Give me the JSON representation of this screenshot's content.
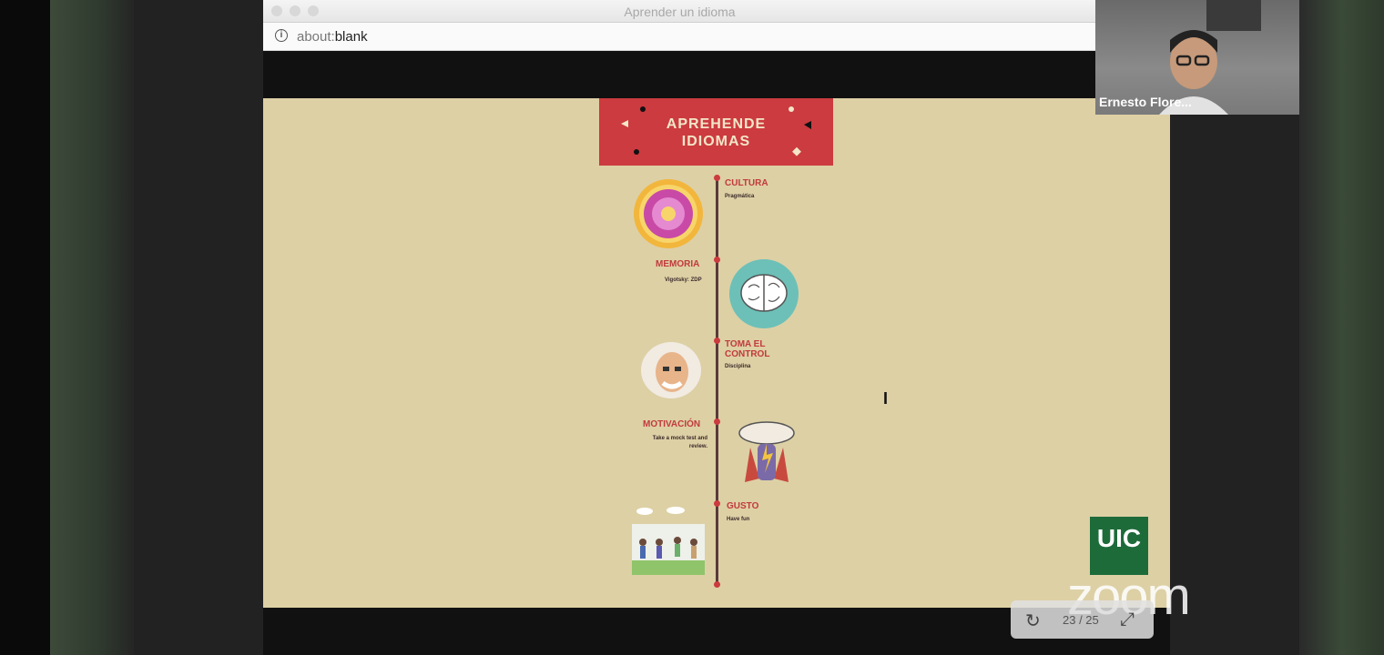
{
  "window": {
    "title": "Aprender un idioma",
    "url_prefix": "about:",
    "url_path": "blank"
  },
  "slide": {
    "banner_line1": "APREHENDE",
    "banner_line2": "IDIOMAS",
    "items": [
      {
        "title": "CULTURA",
        "subtitle": "Pragmática"
      },
      {
        "title": "MEMORIA",
        "subtitle": "Vigotsky: ZDP"
      },
      {
        "title_line1": "TOMA EL",
        "title_line2": "CONTROL",
        "subtitle": "Disciplina"
      },
      {
        "title": "MOTIVACIÓN",
        "subtitle_line1": "Take a mock test and",
        "subtitle_line2": "review."
      },
      {
        "title": "GUSTO",
        "subtitle": "Have fun"
      }
    ]
  },
  "participant": {
    "name": "Ernesto Flore..."
  },
  "logo": {
    "text": "UIC"
  },
  "watermark": {
    "text": "zoom"
  },
  "controls": {
    "page": "23 / 25"
  },
  "colors": {
    "slide_bg": "#ddd0a5",
    "accent_red": "#cb3b3f",
    "uic_green": "#1e6b3a"
  }
}
